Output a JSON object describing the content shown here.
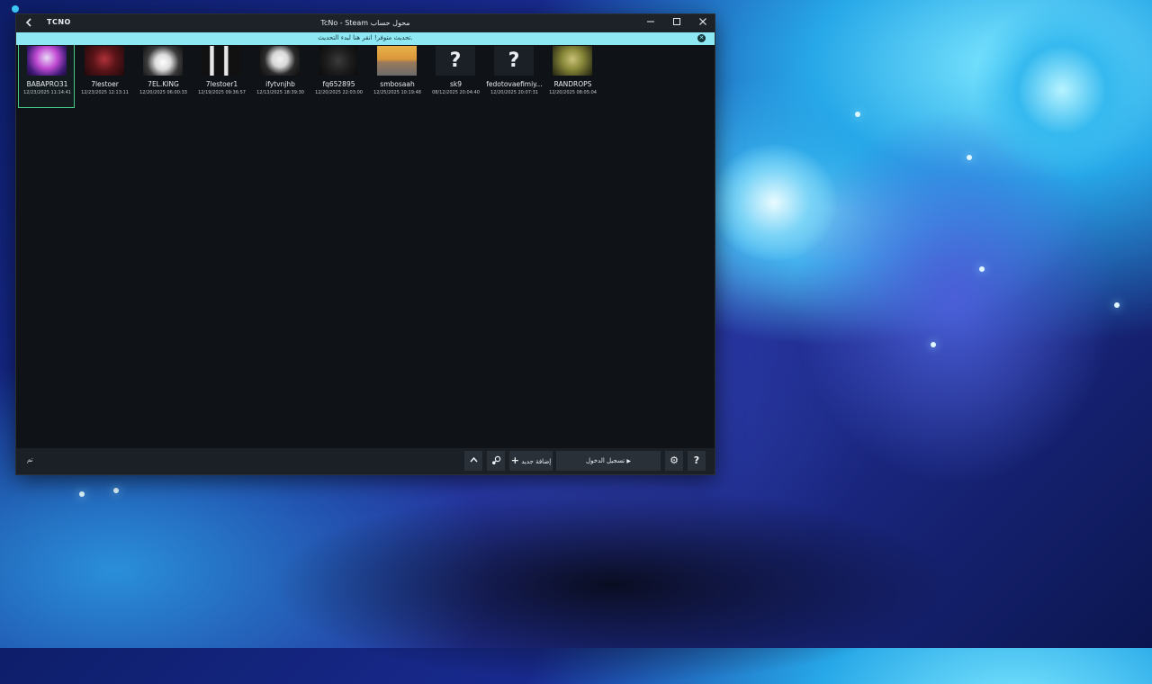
{
  "titlebar": {
    "logo": "TCNO",
    "title": "TcNo - Steam محول حساب",
    "back_icon": "chevron-left-icon",
    "minimize_icon": "minimize-icon",
    "maximize_icon": "maximize-icon",
    "close_icon": "close-icon"
  },
  "banner": {
    "text": "تحديث متوفر! انقر هنا لبدء التحديث.",
    "close_icon": "close-circle-icon",
    "color": "#8ee8f4"
  },
  "accounts": [
    {
      "name": "BABAPRO31",
      "date": "12/23/2025 11:14:41",
      "selected": true
    },
    {
      "name": "7lestoer",
      "date": "12/23/2025 12:13:11",
      "selected": false
    },
    {
      "name": "7EL.KING",
      "date": "12/20/2025 06:00:33",
      "selected": false
    },
    {
      "name": "7lestoer1",
      "date": "12/19/2025 09:36:57",
      "selected": false
    },
    {
      "name": "ifytvnjhb",
      "date": "12/13/2025 18:39:30",
      "selected": false
    },
    {
      "name": "fq652895",
      "date": "12/20/2025 22:03:00",
      "selected": false
    },
    {
      "name": "smbosaah",
      "date": "12/25/2025 10:19:48",
      "selected": false
    },
    {
      "name": "sk9",
      "date": "08/12/2025 20:04:40",
      "selected": false,
      "avatar": "?"
    },
    {
      "name": "fedotovaefimiy...",
      "date": "12/20/2025 20:07:31",
      "selected": false,
      "avatar": "?"
    },
    {
      "name": "RANDROPS",
      "date": "12/20/2025 08:05:04",
      "selected": false
    }
  ],
  "footer": {
    "status": "تم",
    "up_icon": "chevron-up-icon",
    "steam_icon": "steam-icon",
    "add_label": "إضافة جديد",
    "login_label": "تسجيل الدخول",
    "settings_icon": "gear-icon",
    "help_label": "?"
  },
  "colors": {
    "selected_border": "#47c98a",
    "window_bg": "#0f1318",
    "footer_bg": "#1b2026"
  }
}
